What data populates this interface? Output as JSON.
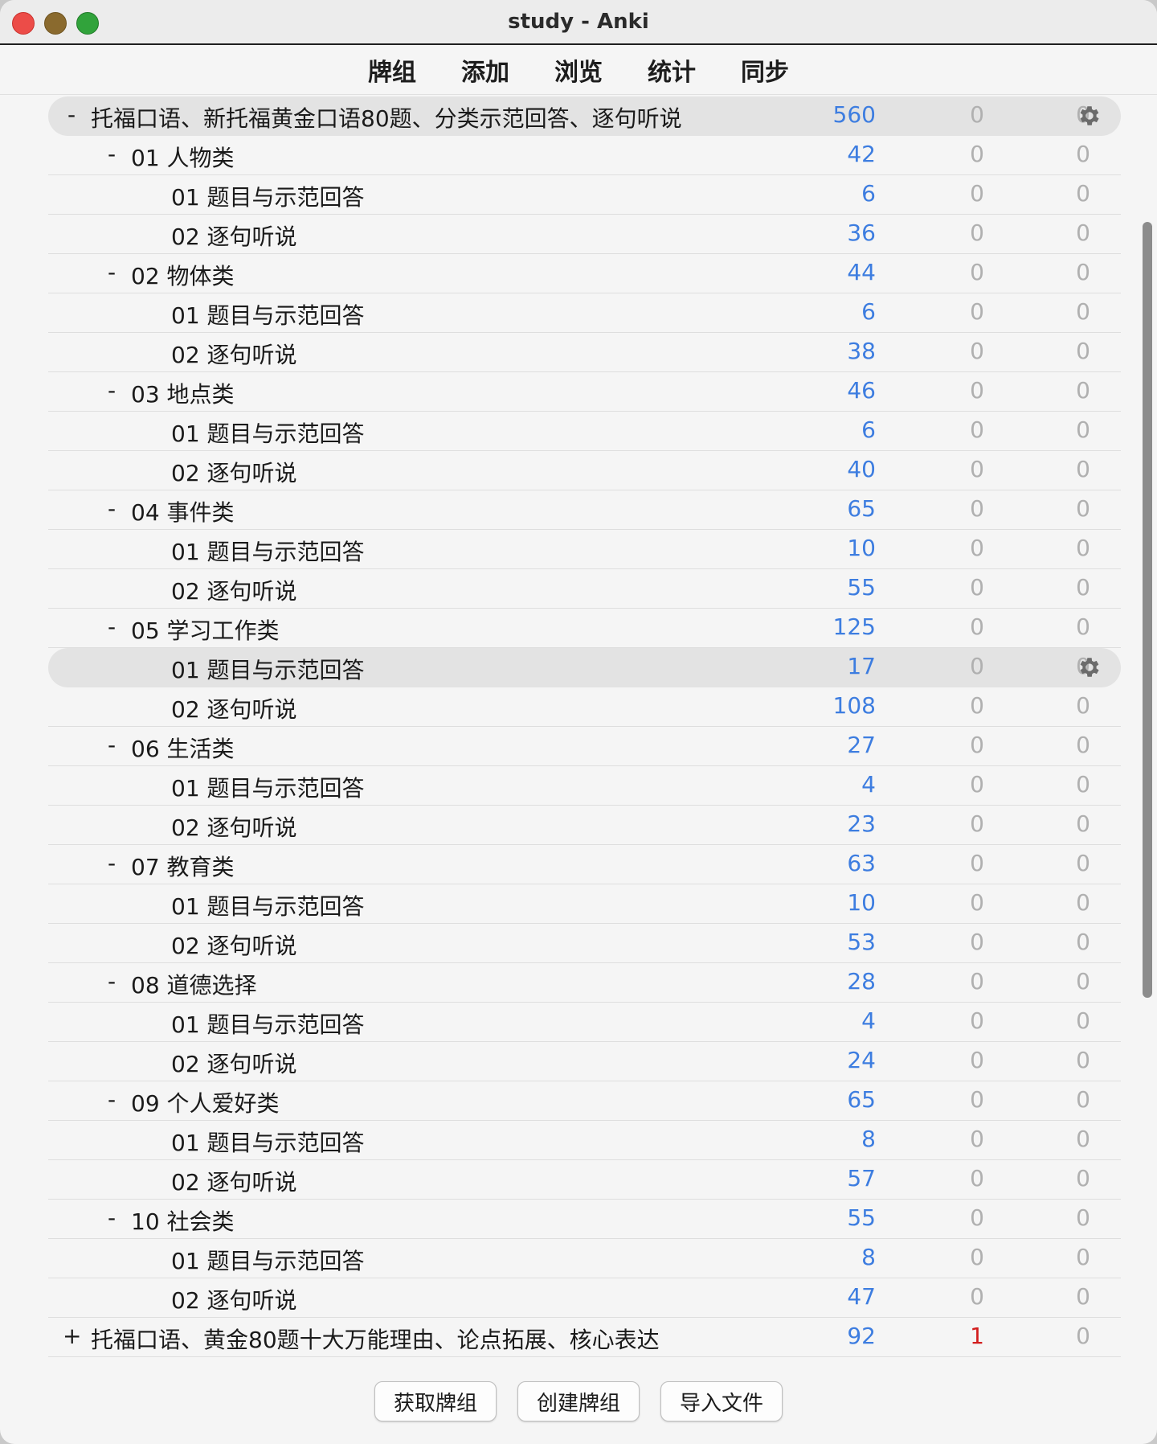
{
  "window": {
    "title": "study - Anki"
  },
  "toolbar": {
    "tabs": [
      "牌组",
      "添加",
      "浏览",
      "统计",
      "同步"
    ]
  },
  "decks": [
    {
      "name": "托福口语、新托福黄金口语80题、分类示范回答、逐句听说",
      "level": 0,
      "toggle": "-",
      "new": "560",
      "learn": "0",
      "due": "0",
      "selected": true
    },
    {
      "name": "01 人物类",
      "level": 1,
      "toggle": "-",
      "new": "42",
      "learn": "0",
      "due": "0"
    },
    {
      "name": "01 题目与示范回答",
      "level": 2,
      "new": "6",
      "learn": "0",
      "due": "0"
    },
    {
      "name": "02 逐句听说",
      "level": 2,
      "new": "36",
      "learn": "0",
      "due": "0"
    },
    {
      "name": "02 物体类",
      "level": 1,
      "toggle": "-",
      "new": "44",
      "learn": "0",
      "due": "0"
    },
    {
      "name": "01 题目与示范回答",
      "level": 2,
      "new": "6",
      "learn": "0",
      "due": "0"
    },
    {
      "name": "02 逐句听说",
      "level": 2,
      "new": "38",
      "learn": "0",
      "due": "0"
    },
    {
      "name": "03 地点类",
      "level": 1,
      "toggle": "-",
      "new": "46",
      "learn": "0",
      "due": "0"
    },
    {
      "name": "01 题目与示范回答",
      "level": 2,
      "new": "6",
      "learn": "0",
      "due": "0"
    },
    {
      "name": "02 逐句听说",
      "level": 2,
      "new": "40",
      "learn": "0",
      "due": "0"
    },
    {
      "name": "04 事件类",
      "level": 1,
      "toggle": "-",
      "new": "65",
      "learn": "0",
      "due": "0"
    },
    {
      "name": "01 题目与示范回答",
      "level": 2,
      "new": "10",
      "learn": "0",
      "due": "0"
    },
    {
      "name": "02 逐句听说",
      "level": 2,
      "new": "55",
      "learn": "0",
      "due": "0"
    },
    {
      "name": "05 学习工作类",
      "level": 1,
      "toggle": "-",
      "new": "125",
      "learn": "0",
      "due": "0"
    },
    {
      "name": "01 题目与示范回答",
      "level": 2,
      "new": "17",
      "learn": "0",
      "due": "0",
      "selected": true
    },
    {
      "name": "02 逐句听说",
      "level": 2,
      "new": "108",
      "learn": "0",
      "due": "0"
    },
    {
      "name": "06 生活类",
      "level": 1,
      "toggle": "-",
      "new": "27",
      "learn": "0",
      "due": "0"
    },
    {
      "name": "01 题目与示范回答",
      "level": 2,
      "new": "4",
      "learn": "0",
      "due": "0"
    },
    {
      "name": "02 逐句听说",
      "level": 2,
      "new": "23",
      "learn": "0",
      "due": "0"
    },
    {
      "name": "07 教育类",
      "level": 1,
      "toggle": "-",
      "new": "63",
      "learn": "0",
      "due": "0"
    },
    {
      "name": "01 题目与示范回答",
      "level": 2,
      "new": "10",
      "learn": "0",
      "due": "0"
    },
    {
      "name": "02 逐句听说",
      "level": 2,
      "new": "53",
      "learn": "0",
      "due": "0"
    },
    {
      "name": "08 道德选择",
      "level": 1,
      "toggle": "-",
      "new": "28",
      "learn": "0",
      "due": "0"
    },
    {
      "name": "01 题目与示范回答",
      "level": 2,
      "new": "4",
      "learn": "0",
      "due": "0"
    },
    {
      "name": "02 逐句听说",
      "level": 2,
      "new": "24",
      "learn": "0",
      "due": "0"
    },
    {
      "name": "09 个人爱好类",
      "level": 1,
      "toggle": "-",
      "new": "65",
      "learn": "0",
      "due": "0"
    },
    {
      "name": "01 题目与示范回答",
      "level": 2,
      "new": "8",
      "learn": "0",
      "due": "0"
    },
    {
      "name": "02 逐句听说",
      "level": 2,
      "new": "57",
      "learn": "0",
      "due": "0"
    },
    {
      "name": "10 社会类",
      "level": 1,
      "toggle": "-",
      "new": "55",
      "learn": "0",
      "due": "0"
    },
    {
      "name": "01 题目与示范回答",
      "level": 2,
      "new": "8",
      "learn": "0",
      "due": "0"
    },
    {
      "name": "02 逐句听说",
      "level": 2,
      "new": "47",
      "learn": "0",
      "due": "0"
    },
    {
      "name": "托福口语、黄金80题十大万能理由、论点拓展、核心表达",
      "level": 0,
      "toggle": "+",
      "new": "92",
      "learn": "1",
      "due": "0"
    }
  ],
  "footer": {
    "buttons": [
      "获取牌组",
      "创建牌组",
      "导入文件"
    ]
  },
  "colors": {
    "new": "#3d7de0",
    "learn_active": "#d21d1d",
    "zero": "#b0b0b0"
  },
  "icons": {
    "options": "gear-icon"
  }
}
